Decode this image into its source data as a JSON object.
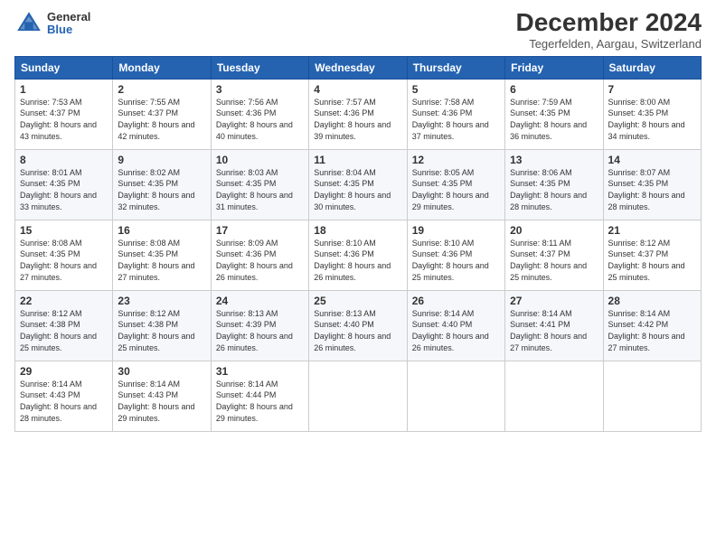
{
  "header": {
    "logo_general": "General",
    "logo_blue": "Blue",
    "title": "December 2024",
    "location": "Tegerfelden, Aargau, Switzerland"
  },
  "weekdays": [
    "Sunday",
    "Monday",
    "Tuesday",
    "Wednesday",
    "Thursday",
    "Friday",
    "Saturday"
  ],
  "weeks": [
    [
      {
        "day": "1",
        "sunrise": "7:53 AM",
        "sunset": "4:37 PM",
        "daylight": "8 hours and 43 minutes."
      },
      {
        "day": "2",
        "sunrise": "7:55 AM",
        "sunset": "4:37 PM",
        "daylight": "8 hours and 42 minutes."
      },
      {
        "day": "3",
        "sunrise": "7:56 AM",
        "sunset": "4:36 PM",
        "daylight": "8 hours and 40 minutes."
      },
      {
        "day": "4",
        "sunrise": "7:57 AM",
        "sunset": "4:36 PM",
        "daylight": "8 hours and 39 minutes."
      },
      {
        "day": "5",
        "sunrise": "7:58 AM",
        "sunset": "4:36 PM",
        "daylight": "8 hours and 37 minutes."
      },
      {
        "day": "6",
        "sunrise": "7:59 AM",
        "sunset": "4:35 PM",
        "daylight": "8 hours and 36 minutes."
      },
      {
        "day": "7",
        "sunrise": "8:00 AM",
        "sunset": "4:35 PM",
        "daylight": "8 hours and 34 minutes."
      }
    ],
    [
      {
        "day": "8",
        "sunrise": "8:01 AM",
        "sunset": "4:35 PM",
        "daylight": "8 hours and 33 minutes."
      },
      {
        "day": "9",
        "sunrise": "8:02 AM",
        "sunset": "4:35 PM",
        "daylight": "8 hours and 32 minutes."
      },
      {
        "day": "10",
        "sunrise": "8:03 AM",
        "sunset": "4:35 PM",
        "daylight": "8 hours and 31 minutes."
      },
      {
        "day": "11",
        "sunrise": "8:04 AM",
        "sunset": "4:35 PM",
        "daylight": "8 hours and 30 minutes."
      },
      {
        "day": "12",
        "sunrise": "8:05 AM",
        "sunset": "4:35 PM",
        "daylight": "8 hours and 29 minutes."
      },
      {
        "day": "13",
        "sunrise": "8:06 AM",
        "sunset": "4:35 PM",
        "daylight": "8 hours and 28 minutes."
      },
      {
        "day": "14",
        "sunrise": "8:07 AM",
        "sunset": "4:35 PM",
        "daylight": "8 hours and 28 minutes."
      }
    ],
    [
      {
        "day": "15",
        "sunrise": "8:08 AM",
        "sunset": "4:35 PM",
        "daylight": "8 hours and 27 minutes."
      },
      {
        "day": "16",
        "sunrise": "8:08 AM",
        "sunset": "4:35 PM",
        "daylight": "8 hours and 27 minutes."
      },
      {
        "day": "17",
        "sunrise": "8:09 AM",
        "sunset": "4:36 PM",
        "daylight": "8 hours and 26 minutes."
      },
      {
        "day": "18",
        "sunrise": "8:10 AM",
        "sunset": "4:36 PM",
        "daylight": "8 hours and 26 minutes."
      },
      {
        "day": "19",
        "sunrise": "8:10 AM",
        "sunset": "4:36 PM",
        "daylight": "8 hours and 25 minutes."
      },
      {
        "day": "20",
        "sunrise": "8:11 AM",
        "sunset": "4:37 PM",
        "daylight": "8 hours and 25 minutes."
      },
      {
        "day": "21",
        "sunrise": "8:12 AM",
        "sunset": "4:37 PM",
        "daylight": "8 hours and 25 minutes."
      }
    ],
    [
      {
        "day": "22",
        "sunrise": "8:12 AM",
        "sunset": "4:38 PM",
        "daylight": "8 hours and 25 minutes."
      },
      {
        "day": "23",
        "sunrise": "8:12 AM",
        "sunset": "4:38 PM",
        "daylight": "8 hours and 25 minutes."
      },
      {
        "day": "24",
        "sunrise": "8:13 AM",
        "sunset": "4:39 PM",
        "daylight": "8 hours and 26 minutes."
      },
      {
        "day": "25",
        "sunrise": "8:13 AM",
        "sunset": "4:40 PM",
        "daylight": "8 hours and 26 minutes."
      },
      {
        "day": "26",
        "sunrise": "8:14 AM",
        "sunset": "4:40 PM",
        "daylight": "8 hours and 26 minutes."
      },
      {
        "day": "27",
        "sunrise": "8:14 AM",
        "sunset": "4:41 PM",
        "daylight": "8 hours and 27 minutes."
      },
      {
        "day": "28",
        "sunrise": "8:14 AM",
        "sunset": "4:42 PM",
        "daylight": "8 hours and 27 minutes."
      }
    ],
    [
      {
        "day": "29",
        "sunrise": "8:14 AM",
        "sunset": "4:43 PM",
        "daylight": "8 hours and 28 minutes."
      },
      {
        "day": "30",
        "sunrise": "8:14 AM",
        "sunset": "4:43 PM",
        "daylight": "8 hours and 29 minutes."
      },
      {
        "day": "31",
        "sunrise": "8:14 AM",
        "sunset": "4:44 PM",
        "daylight": "8 hours and 29 minutes."
      },
      null,
      null,
      null,
      null
    ]
  ],
  "labels": {
    "sunrise": "Sunrise:",
    "sunset": "Sunset:",
    "daylight": "Daylight:"
  }
}
